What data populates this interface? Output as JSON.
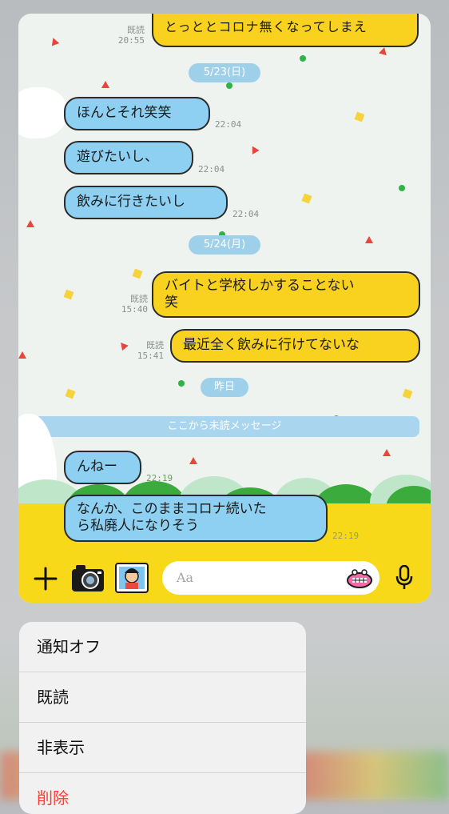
{
  "chat": {
    "top_message": {
      "text": "とっととコロナ無くなってしまえ",
      "read": "既読",
      "time": "20:55"
    },
    "date_1": "5/23(日)",
    "left_1": {
      "text": "ほんとそれ笑笑",
      "time": "22:04"
    },
    "left_2": {
      "text": "遊びたいし、",
      "time": "22:04"
    },
    "left_3": {
      "text": "飲みに行きたいし",
      "time": "22:04"
    },
    "date_2": "5/24(月)",
    "right_1": {
      "line1": "バイトと学校しかすることない",
      "line2": "笑",
      "read": "既読",
      "time": "15:40"
    },
    "right_2": {
      "text": "最近全く飲みに行けてないな",
      "read": "既読",
      "time": "15:41"
    },
    "date_3": "昨日",
    "unread_divider": "ここから未読メッセージ",
    "left_4": {
      "text": "んねー",
      "time": "22:19"
    },
    "left_5": {
      "line1": "なんか、このままコロナ続いた",
      "line2": "ら私廃人になりそう",
      "time": "22:19"
    }
  },
  "toolbar": {
    "plus_icon": "plus-icon",
    "camera_icon": "camera-icon",
    "photo_icon": "photo-icon",
    "input_placeholder": "Aa",
    "emoji_icon": "emoji-icon",
    "mic_icon": "mic-icon"
  },
  "menu": {
    "items": [
      "通知オフ",
      "既読",
      "非表示",
      "削除"
    ]
  },
  "colors": {
    "left_bubble": "#8dd0f2",
    "right_bubble": "#f8d21e",
    "toolbar": "#f8d919",
    "delete": "#ff3b30"
  }
}
